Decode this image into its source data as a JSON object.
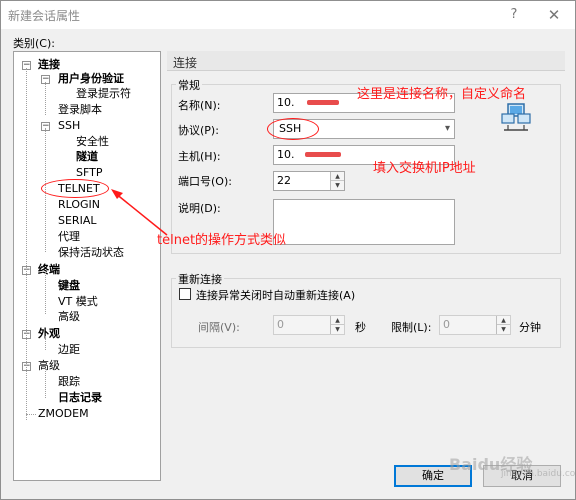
{
  "window": {
    "title": "新建会话属性",
    "help_glyph": "?",
    "close_glyph": "✕"
  },
  "category_label": "类别(C):",
  "tree": {
    "items": [
      {
        "label": "连接",
        "bold": true
      },
      {
        "label": "用户身份验证",
        "bold": true
      },
      {
        "label": "登录提示符",
        "bold": false
      },
      {
        "label": "登录脚本",
        "bold": false
      },
      {
        "label": "SSH",
        "bold": false
      },
      {
        "label": "安全性",
        "bold": false
      },
      {
        "label": "隧道",
        "bold": true
      },
      {
        "label": "SFTP",
        "bold": false
      },
      {
        "label": "TELNET",
        "bold": false
      },
      {
        "label": "RLOGIN",
        "bold": false
      },
      {
        "label": "SERIAL",
        "bold": false
      },
      {
        "label": "代理",
        "bold": false
      },
      {
        "label": "保持活动状态",
        "bold": false
      },
      {
        "label": "终端",
        "bold": true
      },
      {
        "label": "键盘",
        "bold": true
      },
      {
        "label": "VT 模式",
        "bold": false
      },
      {
        "label": "高级",
        "bold": false
      },
      {
        "label": "外观",
        "bold": true
      },
      {
        "label": "边距",
        "bold": false
      },
      {
        "label": "高级",
        "bold": false
      },
      {
        "label": "跟踪",
        "bold": false
      },
      {
        "label": "日志记录",
        "bold": true
      },
      {
        "label": "ZMODEM",
        "bold": false
      }
    ]
  },
  "panel": {
    "header": "连接",
    "general_group": "常规",
    "name_label": "名称(N):",
    "name_value": "10.",
    "protocol_label": "协议(P):",
    "protocol_value": "SSH",
    "host_label": "主机(H):",
    "host_value": "10.",
    "port_label": "端口号(O):",
    "port_value": "22",
    "desc_label": "说明(D):",
    "desc_value": "",
    "reconnect_group": "重新连接",
    "reconnect_checkbox_label": "连接异常关闭时自动重新连接(A)",
    "interval_label": "间隔(V):",
    "interval_value": "0",
    "interval_unit": "秒",
    "limit_label": "限制(L):",
    "limit_value": "0",
    "limit_unit": "分钟"
  },
  "buttons": {
    "ok": "确定",
    "cancel": "取消"
  },
  "annotations": {
    "name_note": "这里是连接名称，自定义命名",
    "host_note": "填入交换机IP地址",
    "telnet_note": "telnet的操作方式类似"
  },
  "watermark": {
    "text": "Baidu经验",
    "sub": "jingyan.baidu.com"
  },
  "colors": {
    "annotation": "#ff1a1a",
    "primary_border": "#0078d7"
  }
}
